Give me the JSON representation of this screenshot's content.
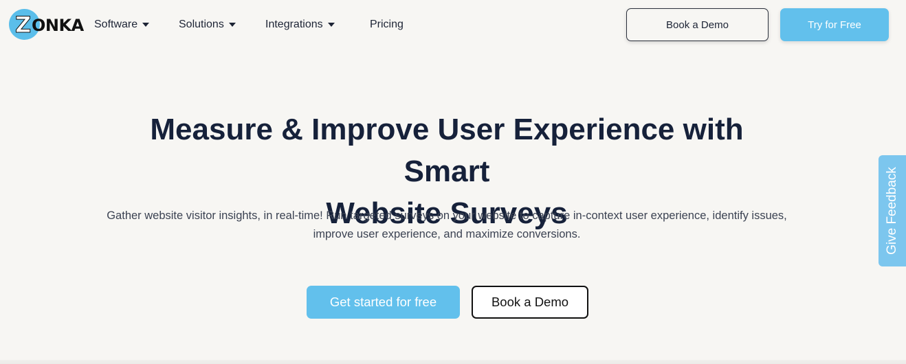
{
  "brand": {
    "logo_letter": "Z",
    "logo_text": "ONKA",
    "accent_color": "#62c0ec"
  },
  "nav": {
    "items": [
      {
        "label": "Software",
        "has_dropdown": true
      },
      {
        "label": "Solutions",
        "has_dropdown": true
      },
      {
        "label": "Integrations",
        "has_dropdown": true
      },
      {
        "label": "Pricing",
        "has_dropdown": false
      }
    ],
    "book_demo_label": "Book a Demo",
    "try_free_label": "Try for Free"
  },
  "hero": {
    "title_line1": "Measure & Improve User Experience with Smart",
    "title_line2": "Website Surveys",
    "subtitle_line1": "Gather website visitor insights, in real-time! Run targeted surveys on your website to capture in-context user experience, identify issues,",
    "subtitle_line2": "improve user experience, and maximize conversions.",
    "primary_cta": "Get started for free",
    "secondary_cta": "Book a Demo"
  },
  "feedback_tab": {
    "label": "Give Feedback"
  }
}
